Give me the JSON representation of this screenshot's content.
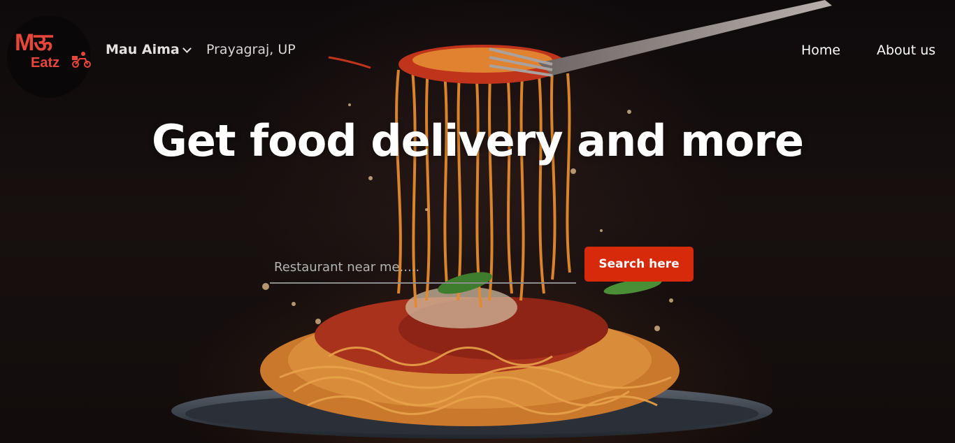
{
  "logo": {
    "line1": "Mऊ",
    "line2": "Eatz"
  },
  "location": {
    "city": "Mau Aima",
    "region": "Prayagraj, UP"
  },
  "nav": {
    "home": "Home",
    "about": "About us"
  },
  "hero": {
    "title": "Get food delivery and more"
  },
  "search": {
    "placeholder": "Restaurant near me.....",
    "button_label": "Search here"
  },
  "colors": {
    "brand": "#e8463a",
    "button": "#d72a0a"
  }
}
